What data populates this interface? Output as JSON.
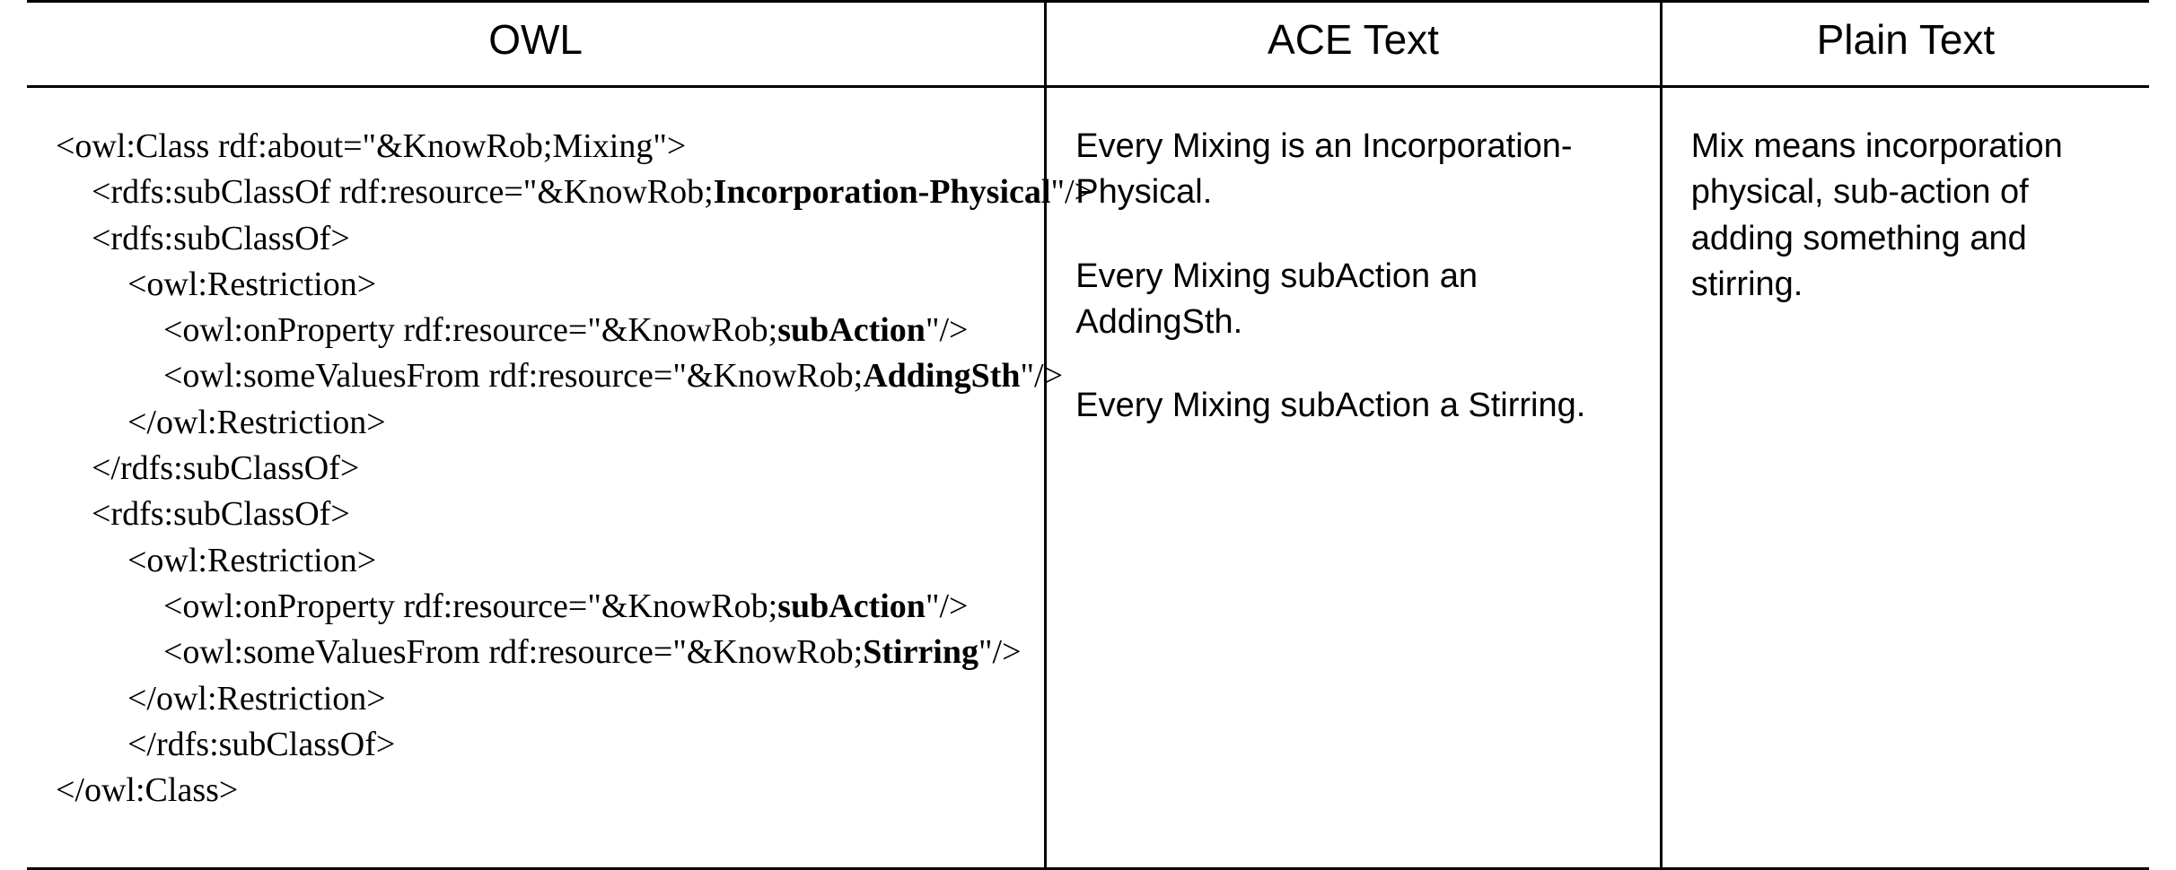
{
  "headers": {
    "owl": "OWL",
    "ace": "ACE Text",
    "plain": "Plain Text"
  },
  "owl": {
    "l1a": "<owl:Class rdf:about=\"&KnowRob;Mixing\">",
    "l2a": "<rdfs:subClassOf rdf:resource=\"&KnowRob;",
    "l2b": "Incorporation-Physical",
    "l2c": "\"/>",
    "l3a": "<rdfs:subClassOf>",
    "l4a": "<owl:Restriction>",
    "l5a": "<owl:onProperty rdf:resource=\"&KnowRob;",
    "l5b": "subAction",
    "l5c": "\"/>",
    "l6a": "<owl:someValuesFrom rdf:resource=\"&KnowRob;",
    "l6b": "AddingSth",
    "l6c": "\"/>",
    "l7a": "</owl:Restriction>",
    "l8a": "</rdfs:subClassOf>",
    "l9a": "<rdfs:subClassOf>",
    "l10a": "<owl:Restriction>",
    "l11a": "<owl:onProperty rdf:resource=\"&KnowRob;",
    "l11b": "subAction",
    "l11c": "\"/>",
    "l12a": "<owl:someValuesFrom rdf:resource=\"&KnowRob;",
    "l12b": "Stirring",
    "l12c": "\"/>",
    "l13a": "</owl:Restriction>",
    "l14a": "</rdfs:subClassOf>",
    "l15a": "</owl:Class>"
  },
  "ace": {
    "s1": "Every Mixing is an Incorporation-Physical.",
    "s2": "Every Mixing subAction an AddingSth.",
    "s3": "Every Mixing subAction a Stirring."
  },
  "plain": {
    "text": "Mix means incorporation physical, sub-action of adding something and stirring."
  }
}
